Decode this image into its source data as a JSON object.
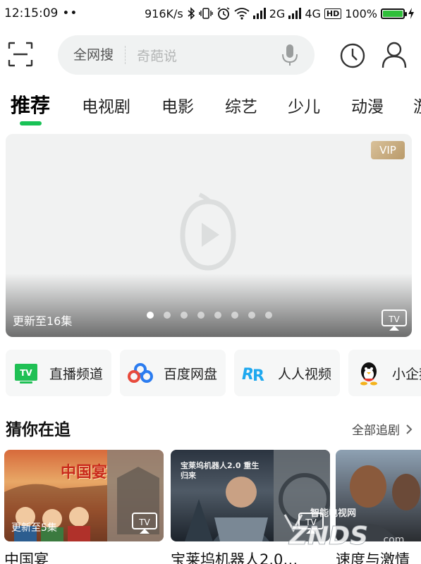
{
  "status_bar": {
    "time": "12:15:09",
    "dots": "••",
    "speed": "916K/s",
    "sim1": "2G",
    "sim2": "4G",
    "hd": "HD",
    "battery": "100%",
    "battery_level": 1.0
  },
  "header": {
    "search_scope": "全网搜",
    "search_placeholder": "奇葩说"
  },
  "tabs": [
    {
      "label": "推荐",
      "active": true
    },
    {
      "label": "电视剧"
    },
    {
      "label": "电影"
    },
    {
      "label": "综艺"
    },
    {
      "label": "少儿"
    },
    {
      "label": "动漫"
    },
    {
      "label": "游"
    }
  ],
  "banner": {
    "vip": "VIP",
    "update": "更新至16集",
    "dot_count": 8,
    "active_dot": 0
  },
  "shortcuts": [
    {
      "label": "直播频道",
      "icon": "tv-icon",
      "color": "#1fc054"
    },
    {
      "label": "百度网盘",
      "icon": "cloud-icon",
      "color": "#2b7cf0"
    },
    {
      "label": "人人视频",
      "icon": "rr-icon",
      "color": "#1ea8ef"
    },
    {
      "label": "小企鹅",
      "icon": "penguin-icon",
      "color": "#111111"
    }
  ],
  "section": {
    "title": "猜你在追",
    "more": "全部追剧"
  },
  "cards": [
    {
      "title": "中国宴",
      "update": "更新至5集",
      "poster_text": "中国宴"
    },
    {
      "title": "宝莱坞机器人2.0…",
      "update": "",
      "poster_text": "宝莱坞机器人2.0 重生归来"
    },
    {
      "title": "速度与激情",
      "update": "",
      "poster_text": ""
    }
  ],
  "watermark": {
    "brand": "ZNDS",
    "sub": "智能电视网",
    "domain": ".com"
  },
  "colors": {
    "accent": "#19c256",
    "search_bg": "#f0f2f2",
    "vip_gold": "#c9ab7c"
  }
}
